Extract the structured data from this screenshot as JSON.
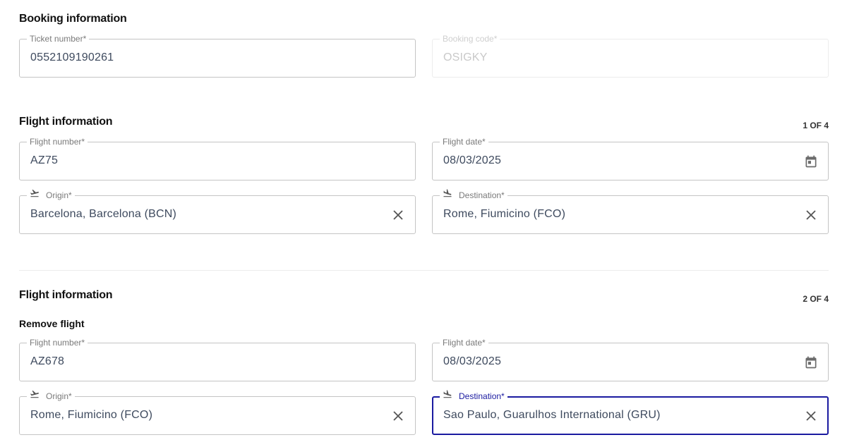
{
  "booking": {
    "title": "Booking information",
    "ticket": {
      "label": "Ticket number*",
      "value": "0552109190261"
    },
    "code": {
      "label": "Booking code*",
      "value": "OSIGKY"
    }
  },
  "flights": [
    {
      "title": "Flight information",
      "counter": "1 OF 4",
      "number": {
        "label": "Flight number*",
        "value": "AZ75"
      },
      "date": {
        "label": "Flight date*",
        "value": "08/03/2025"
      },
      "origin": {
        "label": "Origin*",
        "value": "Barcelona, Barcelona (BCN)"
      },
      "destination": {
        "label": "Destination*",
        "value": "Rome, Fiumicino (FCO)"
      }
    },
    {
      "title": "Flight information",
      "counter": "2 OF 4",
      "remove_label": "Remove flight",
      "number": {
        "label": "Flight number*",
        "value": "AZ678"
      },
      "date": {
        "label": "Flight date*",
        "value": "08/03/2025"
      },
      "origin": {
        "label": "Origin*",
        "value": "Rome, Fiumicino (FCO)"
      },
      "destination": {
        "label": "Destination*",
        "value": "Sao Paulo, Guarulhos International (GRU)"
      }
    }
  ],
  "icons": {
    "takeoff": "flight-takeoff-icon",
    "landing": "flight-land-icon",
    "calendar": "calendar-icon",
    "clear": "close-icon"
  },
  "colors": {
    "focus": "#1a1aa0",
    "border": "#c4c4c4",
    "text": "#3e4a5e",
    "label": "#7a7a7a"
  }
}
